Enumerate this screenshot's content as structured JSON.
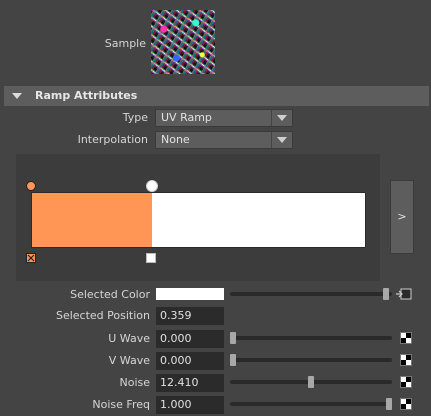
{
  "sample": {
    "label": "Sample"
  },
  "section": {
    "title": "Ramp Attributes"
  },
  "type_field": {
    "label": "Type",
    "value": "UV Ramp"
  },
  "interpolation_field": {
    "label": "Interpolation",
    "value": "None"
  },
  "ramp": {
    "expand_label": ">",
    "colors": {
      "entry1": "#ff9655",
      "entry2": "#ffffff"
    },
    "positions": [
      0.0,
      0.359
    ]
  },
  "selected_color": {
    "label": "Selected Color",
    "value": "#ffffff",
    "slider": 0.98
  },
  "selected_position": {
    "label": "Selected Position",
    "value": "0.359"
  },
  "u_wave": {
    "label": "U Wave",
    "value": "0.000",
    "slider": 0.0
  },
  "v_wave": {
    "label": "V Wave",
    "value": "0.000",
    "slider": 0.0
  },
  "noise": {
    "label": "Noise",
    "value": "12.410",
    "slider": 0.5
  },
  "noise_freq": {
    "label": "Noise Freq",
    "value": "1.000",
    "slider": 1.0
  }
}
